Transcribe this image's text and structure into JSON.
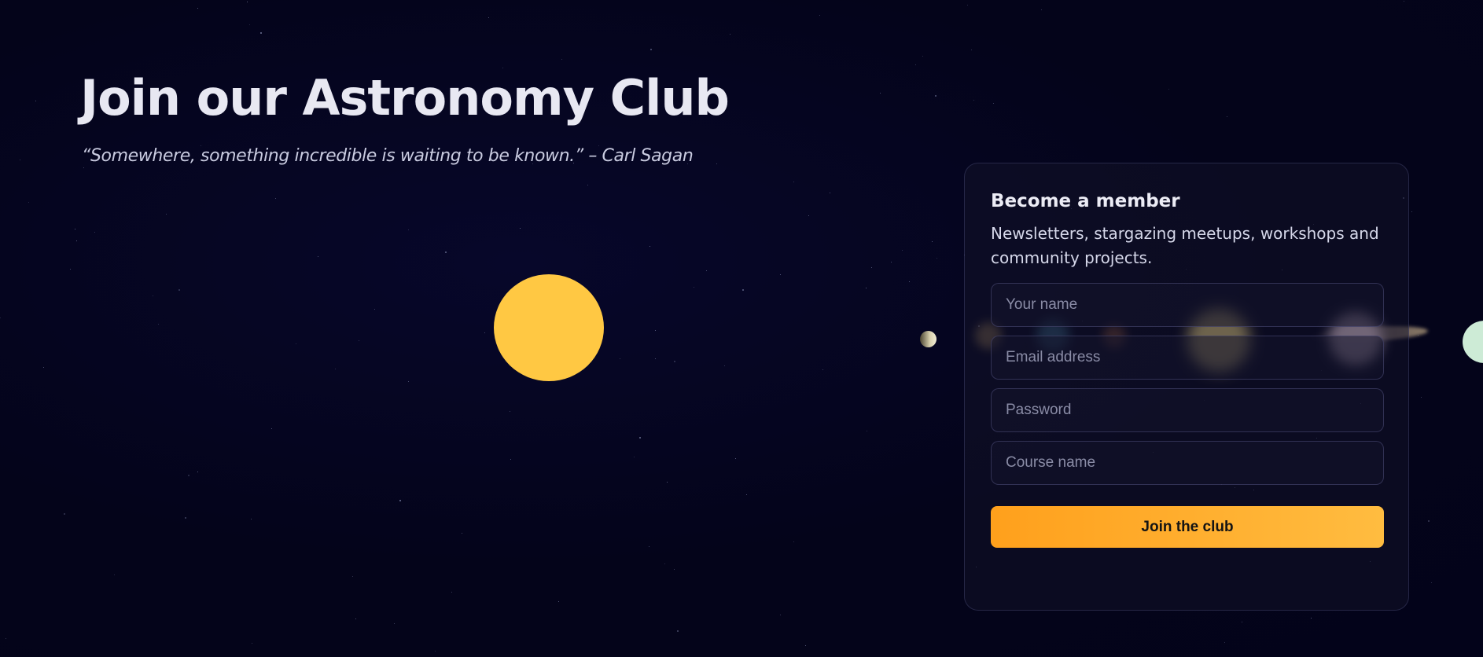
{
  "hero": {
    "title": "Join our Astronomy Club",
    "quote": "“Somewhere, something incredible is waiting to be known.” – Carl Sagan"
  },
  "scene": {
    "sun_color": "#ffc843",
    "planets": [
      "mercury",
      "venus",
      "earth",
      "mars",
      "jupiter",
      "saturn",
      "uranus"
    ]
  },
  "signup": {
    "title": "Become a member",
    "subtitle": "Newsletters, stargazing meetups, workshops and community projects.",
    "fields": {
      "name_placeholder": "Your name",
      "email_placeholder": "Email address",
      "password_placeholder": "Password",
      "course_placeholder": "Course name"
    },
    "submit_label": "Join the club",
    "accent_colors": [
      "#ffa01c",
      "#ffbc40"
    ]
  }
}
